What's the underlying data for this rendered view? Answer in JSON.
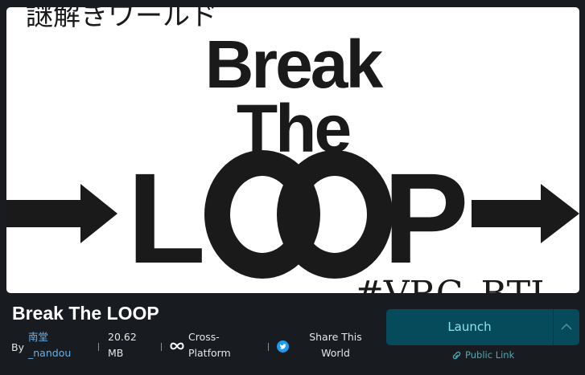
{
  "hero": {
    "jp_title": "謎解きワールド",
    "line1": "Break",
    "line2": "The",
    "loop_l": "L",
    "loop_p": "P",
    "hashtag": "#VRC_BTL"
  },
  "world": {
    "title": "Break The LOOP",
    "by_label": "By",
    "author": "南堂_nandou",
    "size": "20.62 MB",
    "platform": "Cross-Platform",
    "share": "Share This World"
  },
  "actions": {
    "launch": "Launch",
    "public_link": "Public Link"
  },
  "icons": {
    "platform": "infinity-icon",
    "share": "twitter-icon",
    "expand": "chevron-up-icon",
    "link": "link-icon"
  },
  "colors": {
    "background": "#181b1f",
    "launch_bg": "#064b5c",
    "launch_text": "#8fe3f0",
    "link": "#6ab0e6",
    "twitter": "#1d9bf0"
  }
}
